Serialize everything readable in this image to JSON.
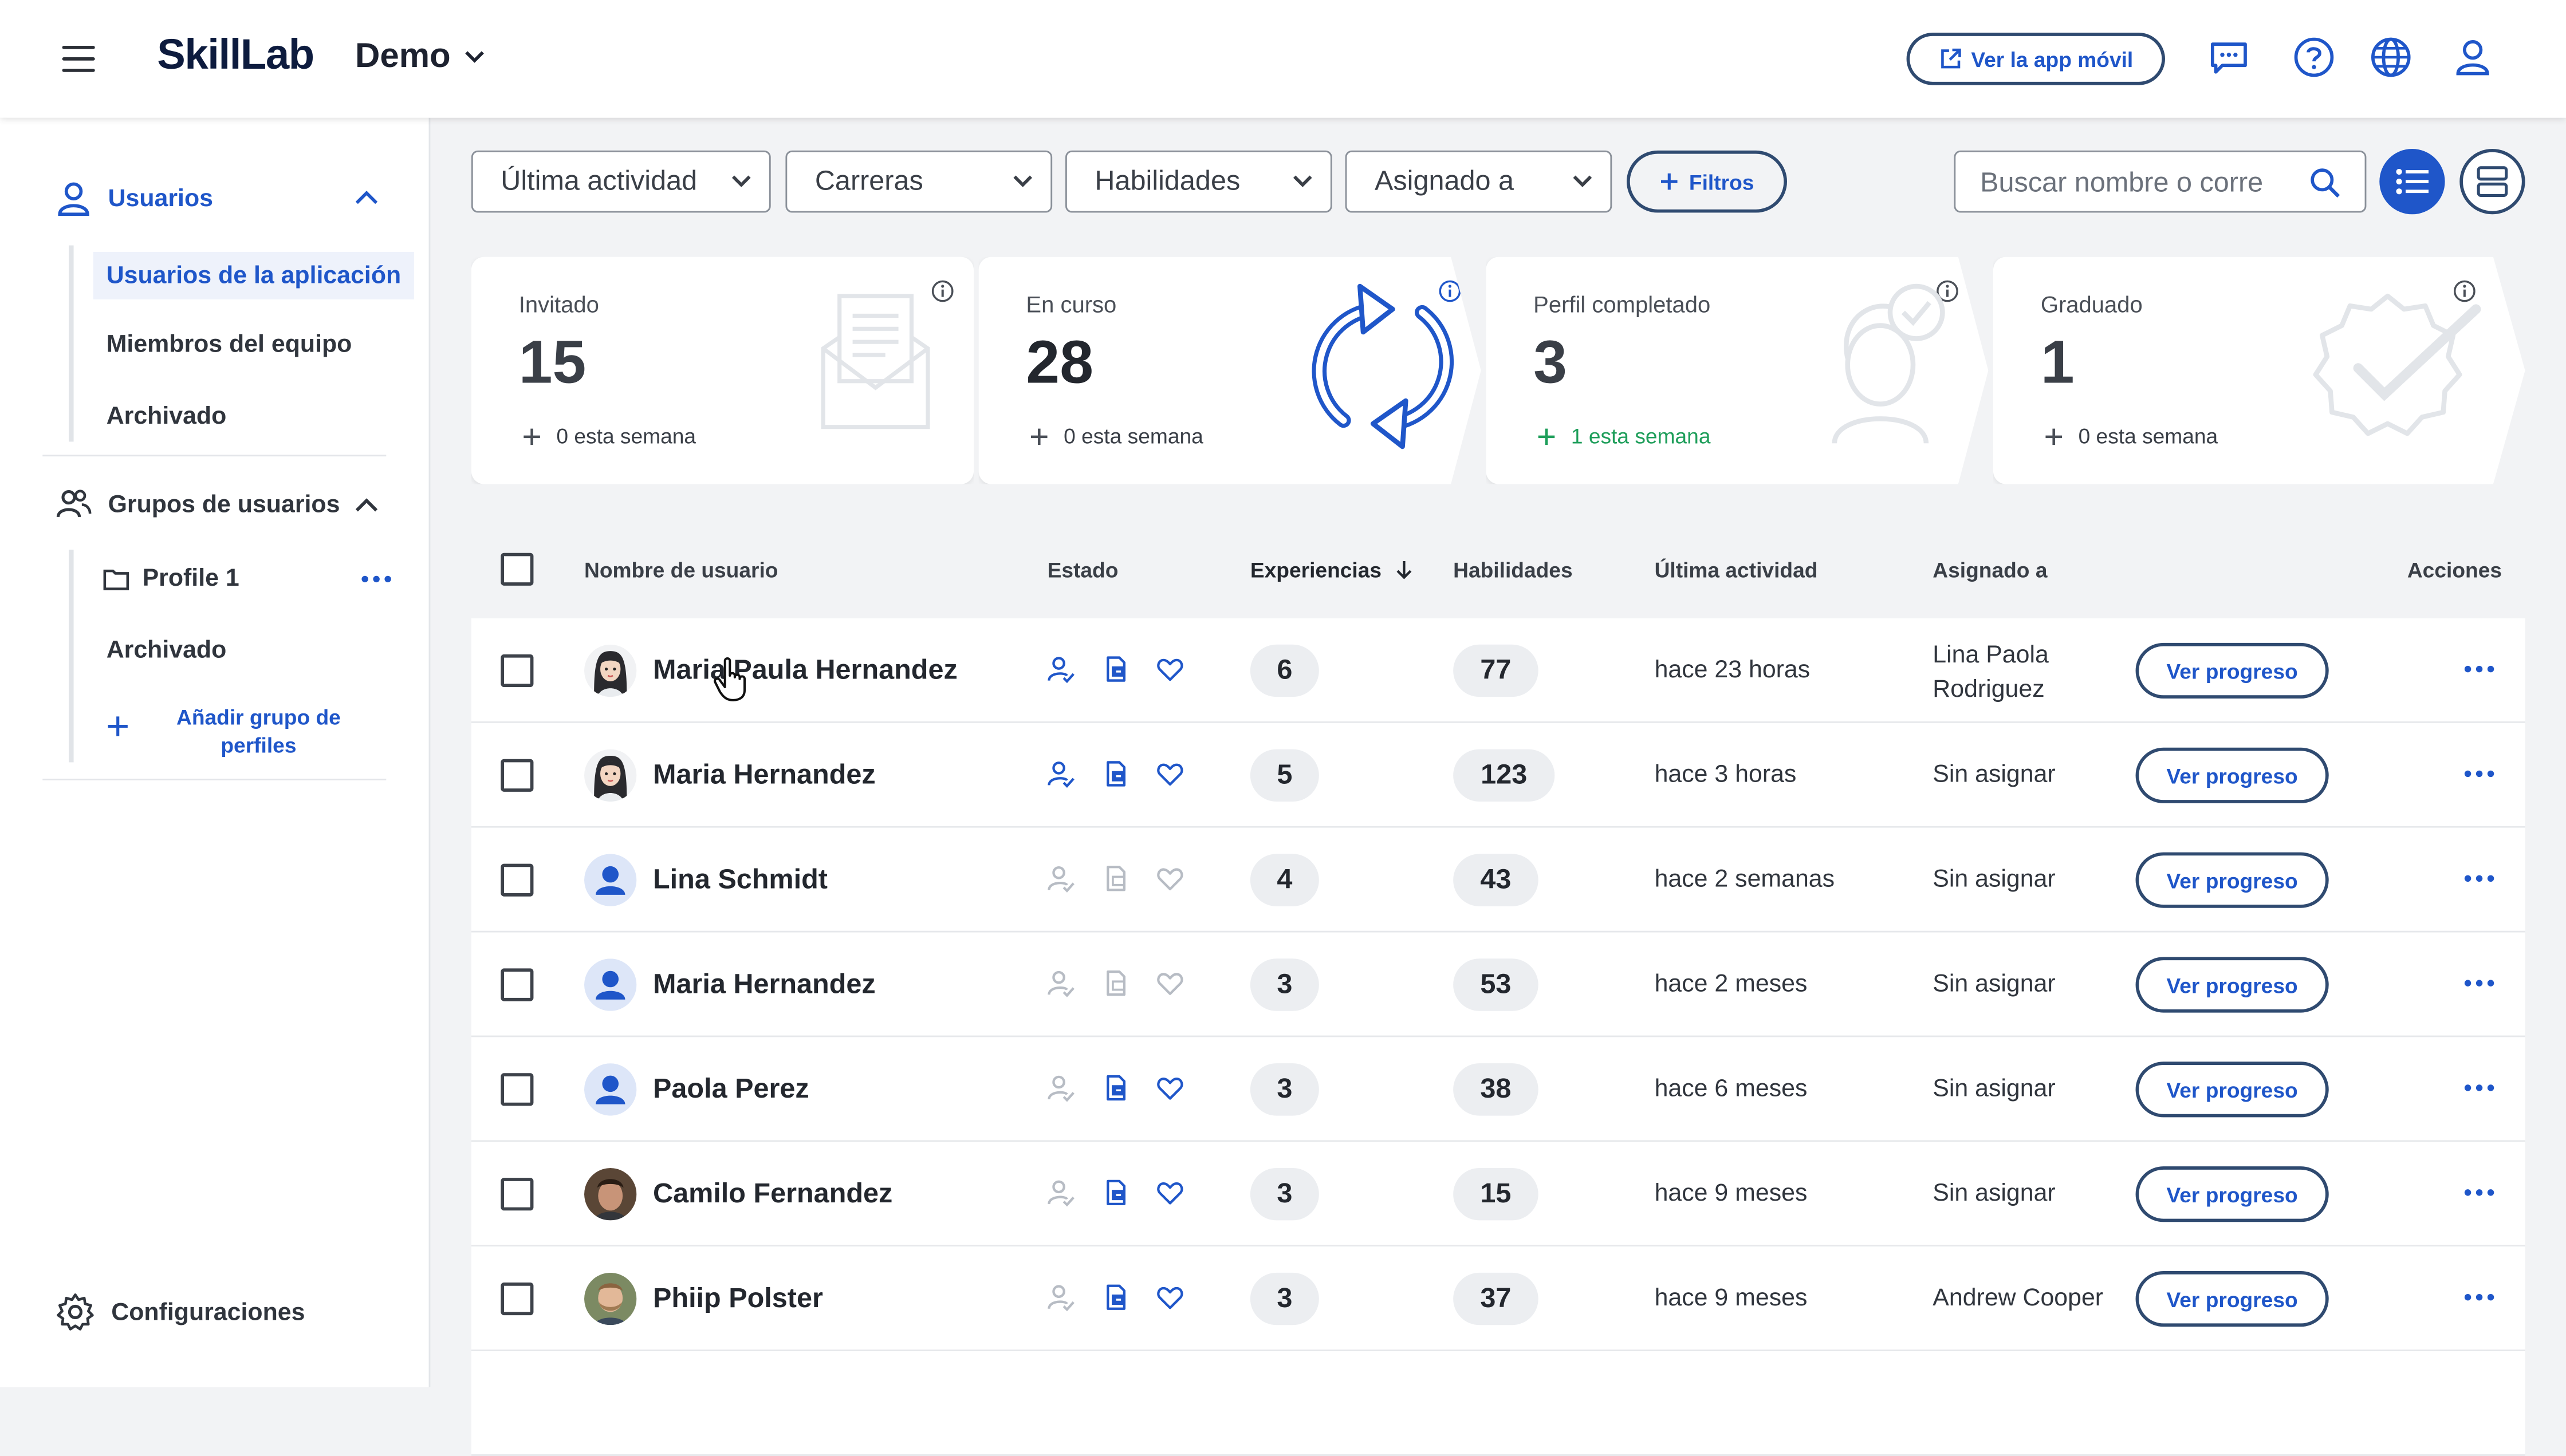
{
  "header": {
    "logo": "SkillLab",
    "org_name": "Demo",
    "mobile_app_label": "Ver la app móvil"
  },
  "sidebar": {
    "users_section": "Usuarios",
    "user_items": [
      "Usuarios de la aplicación",
      "Miembros del equipo",
      "Archivado"
    ],
    "groups_section": "Grupos de usuarios",
    "group_items": [
      "Profile 1",
      "Archivado"
    ],
    "add_group_label_line1": "Añadir grupo de",
    "add_group_label_line2": "perfiles",
    "settings_label": "Configuraciones"
  },
  "filters": {
    "last_activity": "Última actividad",
    "careers": "Carreras",
    "skills": "Habilidades",
    "assigned_to": "Asignado a",
    "filters_button": "Filtros",
    "search_placeholder": "Buscar nombre o corre"
  },
  "cards": [
    {
      "label": "Invitado",
      "count": "15",
      "week": "0 esta semana"
    },
    {
      "label": "En curso",
      "count": "28",
      "week": "0 esta semana"
    },
    {
      "label": "Perfil completado",
      "count": "3",
      "week": "1 esta semana"
    },
    {
      "label": "Graduado",
      "count": "1",
      "week": "0 esta semana"
    }
  ],
  "table": {
    "headers": {
      "name": "Nombre de usuario",
      "status": "Estado",
      "experiences": "Experiencias",
      "skills": "Habilidades",
      "last_activity": "Última actividad",
      "assigned_to": "Asignado a",
      "actions": "Acciones"
    },
    "progress_label": "Ver progreso",
    "rows": [
      {
        "name": "Maria Paula Hernandez",
        "experiences": "6",
        "skills": "77",
        "last_activity": "hace 23 horas",
        "assigned": "Lina Paola Rodriguez",
        "status_active": [
          true,
          true,
          true
        ]
      },
      {
        "name": "Maria Hernandez",
        "experiences": "5",
        "skills": "123",
        "last_activity": "hace 3 horas",
        "assigned": "Sin asignar",
        "status_active": [
          true,
          true,
          true
        ]
      },
      {
        "name": "Lina Schmidt",
        "experiences": "4",
        "skills": "43",
        "last_activity": "hace 2 semanas",
        "assigned": "Sin asignar",
        "status_active": [
          false,
          false,
          false
        ]
      },
      {
        "name": "Maria Hernandez",
        "experiences": "3",
        "skills": "53",
        "last_activity": "hace 2 meses",
        "assigned": "Sin asignar",
        "status_active": [
          false,
          false,
          false
        ]
      },
      {
        "name": "Paola Perez",
        "experiences": "3",
        "skills": "38",
        "last_activity": "hace 6 meses",
        "assigned": "Sin asignar",
        "status_active": [
          false,
          true,
          true
        ]
      },
      {
        "name": "Camilo Fernandez",
        "experiences": "3",
        "skills": "15",
        "last_activity": "hace 9 meses",
        "assigned": "Sin asignar",
        "status_active": [
          false,
          true,
          true
        ]
      },
      {
        "name": "Phiip Polster",
        "experiences": "3",
        "skills": "37",
        "last_activity": "hace 9 meses",
        "assigned": "Andrew Cooper",
        "status_active": [
          false,
          true,
          true
        ]
      }
    ]
  },
  "colors": {
    "accent": "#1f56c9",
    "brand_dark": "#0d1b3e",
    "positive": "#1e9e5a",
    "inactive": "#b7bcc4"
  }
}
